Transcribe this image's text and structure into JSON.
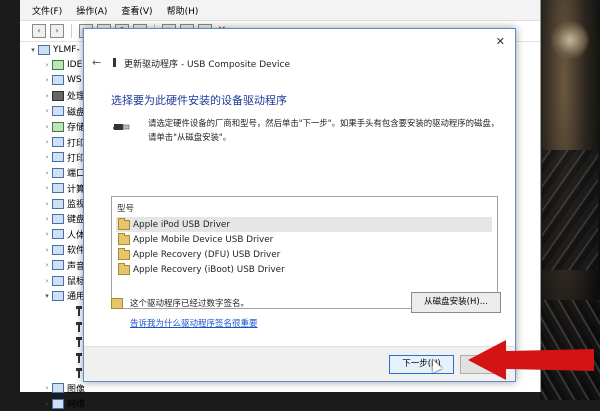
{
  "devmgr": {
    "menu": [
      "文件(F)",
      "操作(A)",
      "查看(V)",
      "帮助(H)"
    ],
    "tree": [
      {
        "label": "YLMF-",
        "arrow": "▾",
        "icon": "computer"
      },
      {
        "label": "IDE",
        "arrow": "›",
        "icon": "green"
      },
      {
        "label": "WS",
        "arrow": "›",
        "icon": "default"
      },
      {
        "label": "处理",
        "arrow": "›",
        "icon": "dark"
      },
      {
        "label": "磁盘",
        "arrow": "›",
        "icon": "default"
      },
      {
        "label": "存储",
        "arrow": "›",
        "icon": "green"
      },
      {
        "label": "打印",
        "arrow": "›",
        "icon": "default"
      },
      {
        "label": "打印",
        "arrow": "›",
        "icon": "default"
      },
      {
        "label": "端口",
        "arrow": "›",
        "icon": "default"
      },
      {
        "label": "计算",
        "arrow": "›",
        "icon": "default"
      },
      {
        "label": "监视",
        "arrow": "›",
        "icon": "default"
      },
      {
        "label": "键盘",
        "arrow": "›",
        "icon": "default"
      },
      {
        "label": "人体",
        "arrow": "›",
        "icon": "default"
      },
      {
        "label": "软件",
        "arrow": "›",
        "icon": "default"
      },
      {
        "label": "声音",
        "arrow": "›",
        "icon": "default"
      },
      {
        "label": "鼠标",
        "arrow": "›",
        "icon": "default"
      },
      {
        "label": "通用",
        "arrow": "▾",
        "icon": "default"
      },
      {
        "label": "",
        "arrow": "",
        "icon": "usb"
      },
      {
        "label": "",
        "arrow": "",
        "icon": "usb"
      },
      {
        "label": "",
        "arrow": "",
        "icon": "usb"
      },
      {
        "label": "",
        "arrow": "",
        "icon": "usb"
      },
      {
        "label": "",
        "arrow": "",
        "icon": "usb"
      },
      {
        "label": "图像",
        "arrow": "›",
        "icon": "default"
      },
      {
        "label": "网络",
        "arrow": "›",
        "icon": "default"
      }
    ]
  },
  "dialog": {
    "title": "更新驱动程序 - USB Composite Device",
    "heading": "选择要为此硬件安装的设备驱动程序",
    "desc_line1": "请选定硬件设备的厂商和型号，然后单击\"下一步\"。如果手头有包含要安装的驱动程序的磁盘，",
    "desc_line2": "请单击\"从磁盘安装\"。",
    "list_header": "型号",
    "drivers": [
      "Apple iPod USB Driver",
      "Apple Mobile Device USB Driver",
      "Apple Recovery (DFU) USB Driver",
      "Apple Recovery (iBoot) USB Driver"
    ],
    "selected_index": 0,
    "signed_text": "这个驱动程序已经过数字签名。",
    "signing_link": "告诉我为什么驱动程序签名很重要",
    "have_disk_label": "从磁盘安装(H)...",
    "next_label": "下一步(N)"
  },
  "colors": {
    "heading": "#1e3b9a",
    "link": "#1a53c8",
    "arrow": "#d41414"
  }
}
